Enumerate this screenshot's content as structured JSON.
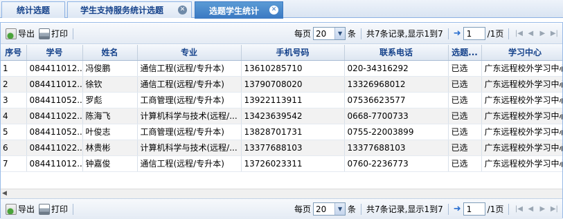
{
  "tabs": [
    {
      "label": "统计选题",
      "closable": false,
      "active": false
    },
    {
      "label": "学生支持服务统计选题",
      "closable": true,
      "active": false
    },
    {
      "label": "选题学生统计",
      "closable": true,
      "active": true
    }
  ],
  "toolbar": {
    "export_label": "导出",
    "print_label": "打印",
    "per_page_label": "每页",
    "per_page_value": "20",
    "per_page_unit": "条",
    "summary": "共7条记录,显示1到7",
    "page_input_value": "1",
    "page_total": "/1页"
  },
  "grid": {
    "columns": [
      "序号",
      "学号",
      "姓名",
      "专业",
      "手机号码",
      "联系电话",
      "选题...",
      "学习中心"
    ],
    "rows": [
      [
        "1",
        "084411012...",
        "冯俊鹏",
        "通信工程(远程/专升本)",
        "13610285710",
        "020-34316292",
        "已选",
        "广东远程校外学习中心"
      ],
      [
        "2",
        "084411012...",
        "徐钦",
        "通信工程(远程/专升本)",
        "13790708020",
        "13326968012",
        "已选",
        "广东远程校外学习中心"
      ],
      [
        "3",
        "084411052...",
        "罗彪",
        "工商管理(远程/专升本)",
        "13922113911",
        "07536623577",
        "已选",
        "广东远程校外学习中心"
      ],
      [
        "4",
        "084411022...",
        "陈海飞",
        "计算机科学与技术(远程/...",
        "13423639542",
        "0668-7700733",
        "已选",
        "广东远程校外学习中心"
      ],
      [
        "5",
        "084411052...",
        "叶俊志",
        "工商管理(远程/专升本)",
        "13828701731",
        "0755-22003899",
        "已选",
        "广东远程校外学习中心"
      ],
      [
        "6",
        "084411022...",
        "林贵彬",
        "计算机科学与技术(远程/...",
        "13377688103",
        "13377688103",
        "已选",
        "广东远程校外学习中心"
      ],
      [
        "7",
        "084411012...",
        "钟嘉俊",
        "通信工程(远程/专升本)",
        "13726023311",
        "0760-2236773",
        "已选",
        "广东远程校外学习中心"
      ]
    ]
  }
}
